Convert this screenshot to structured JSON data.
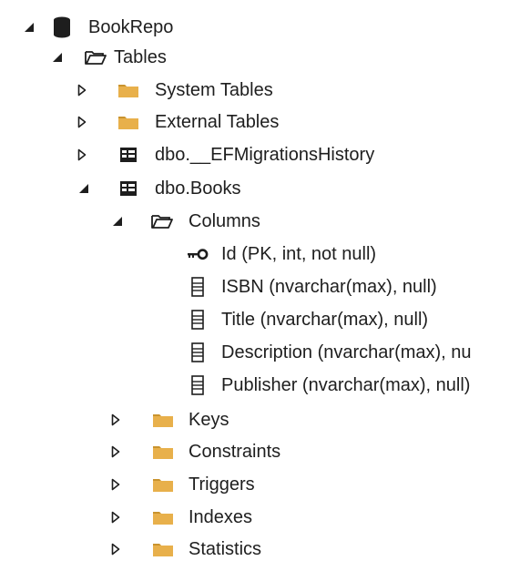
{
  "tree": {
    "database": {
      "label": "BookRepo",
      "icon": "database-icon",
      "expanded": true
    },
    "tables": {
      "label": "Tables",
      "icon": "folder-open-icon",
      "expanded": true
    },
    "system_tables": {
      "label": "System Tables",
      "icon": "folder-icon",
      "expanded": false
    },
    "external_tables": {
      "label": "External Tables",
      "icon": "folder-icon",
      "expanded": false
    },
    "migrations_history": {
      "label": "dbo.__EFMigrationsHistory",
      "icon": "table-icon",
      "expanded": false
    },
    "books": {
      "label": "dbo.Books",
      "icon": "table-icon",
      "expanded": true
    },
    "columns": {
      "label": "Columns",
      "icon": "folder-open-icon",
      "expanded": true,
      "items": [
        {
          "label": "Id (PK, int, not null)",
          "icon": "key-icon"
        },
        {
          "label": "ISBN (nvarchar(max), null)",
          "icon": "column-icon"
        },
        {
          "label": "Title (nvarchar(max), null)",
          "icon": "column-icon"
        },
        {
          "label": "Description (nvarchar(max), nu",
          "icon": "column-icon"
        },
        {
          "label": "Publisher (nvarchar(max), null)",
          "icon": "column-icon"
        }
      ]
    },
    "keys": {
      "label": "Keys",
      "icon": "folder-icon",
      "expanded": false
    },
    "constraints": {
      "label": "Constraints",
      "icon": "folder-icon",
      "expanded": false
    },
    "triggers": {
      "label": "Triggers",
      "icon": "folder-icon",
      "expanded": false
    },
    "indexes": {
      "label": "Indexes",
      "icon": "folder-icon",
      "expanded": false
    },
    "statistics": {
      "label": "Statistics",
      "icon": "folder-icon",
      "expanded": false
    }
  },
  "colors": {
    "folder": "#E8B04B",
    "folder_dark": "#C9932E",
    "glyph": "#1E1E1E",
    "text": "#1E1E1E"
  }
}
